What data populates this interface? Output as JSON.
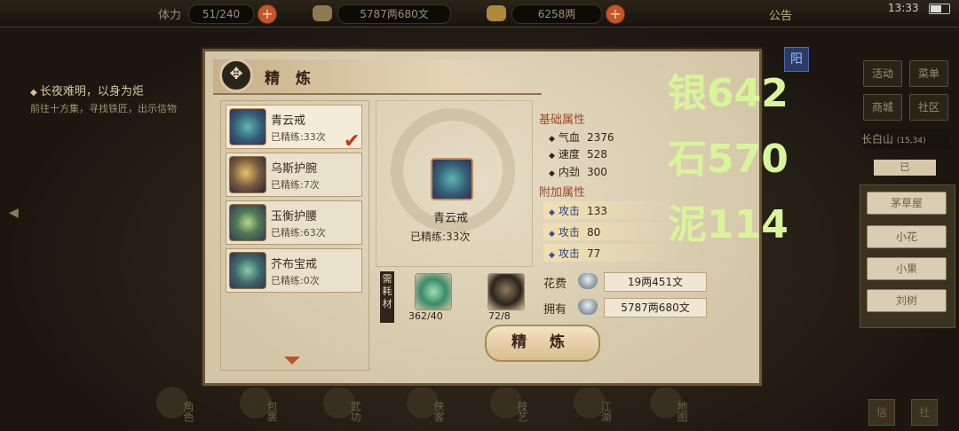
{
  "topbar": {
    "stamina_label": "体力",
    "stamina_value": "51/240",
    "silver_value": "5787两680文",
    "gold_value": "6258两",
    "notice": "公告",
    "clock": "13:33"
  },
  "quest": {
    "title": "长夜难明，以身为炬",
    "desc": "前往十方集，寻找铁匠，出示信物"
  },
  "right_menu": {
    "activity": "活动",
    "menu": "菜单",
    "shop": "商城",
    "community": "社区",
    "location": "长白山",
    "coords": "(15,34)",
    "tab": "已",
    "npcs": [
      "茅草屋",
      "小花",
      "小果",
      "刘树"
    ]
  },
  "dock": [
    "角色",
    "包裹",
    "武功",
    "侠客",
    "技艺",
    "江湖",
    "地图"
  ],
  "corner_buttons": [
    "信",
    "社"
  ],
  "dialog": {
    "title": "精 炼",
    "yang": "阳",
    "items": [
      {
        "name": "青云戒",
        "refine": "已精练:33次",
        "selected": true
      },
      {
        "name": "乌斯护腕",
        "refine": "已精练:7次",
        "selected": false
      },
      {
        "name": "玉衡护腰",
        "refine": "已精练:63次",
        "selected": false
      },
      {
        "name": "芥布宝戒",
        "refine": "已精练:0次",
        "selected": false
      }
    ],
    "selected_name": "青云戒",
    "selected_refine": "已精练:33次",
    "base_attr_title": "基础属性",
    "base_attrs": [
      {
        "name": "气血",
        "value": "2376"
      },
      {
        "name": "速度",
        "value": "528"
      },
      {
        "name": "内劲",
        "value": "300"
      }
    ],
    "bonus_attr_title": "附加属性",
    "bonus_attrs": [
      {
        "name": "攻击",
        "value": "133"
      },
      {
        "name": "攻击",
        "value": "80"
      },
      {
        "name": "攻击",
        "value": "77"
      }
    ],
    "materials_label": "需耗材",
    "materials": [
      {
        "icon": "jade-icon",
        "qty": "362/40"
      },
      {
        "icon": "pot-icon",
        "qty": "72/8"
      }
    ],
    "cost_label": "花费",
    "cost_value": "19两451文",
    "own_label": "拥有",
    "own_value": "5787两680文",
    "refine_button": "精 炼"
  },
  "overlay": {
    "line1": "银642",
    "line2": "石570",
    "line3": "泥114"
  },
  "colors": {
    "overlay": "#d9f59a",
    "accent_red": "#c4562a",
    "bonus_blue": "#2e3f78"
  }
}
